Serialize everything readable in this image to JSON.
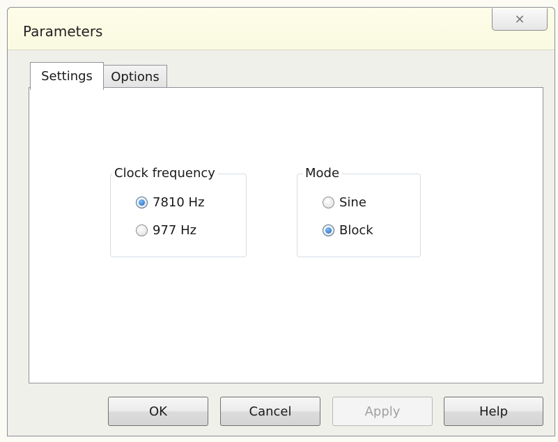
{
  "dialog": {
    "title": "Parameters",
    "close_glyph": "⨯"
  },
  "tabs": [
    {
      "label": "Settings",
      "selected": true
    },
    {
      "label": "Options",
      "selected": false
    }
  ],
  "clock_frequency": {
    "legend": "Clock frequency",
    "options": [
      {
        "label": "7810 Hz",
        "checked": true
      },
      {
        "label": "977 Hz",
        "checked": false
      }
    ]
  },
  "mode": {
    "legend": "Mode",
    "options": [
      {
        "label": "Sine",
        "checked": false
      },
      {
        "label": "Block",
        "checked": true
      }
    ]
  },
  "buttons": {
    "ok": "OK",
    "cancel": "Cancel",
    "apply": "Apply",
    "apply_enabled": false,
    "help": "Help"
  },
  "colors": {
    "radio_selected": "#1a5fb4",
    "title_bar": "#fafae2"
  }
}
